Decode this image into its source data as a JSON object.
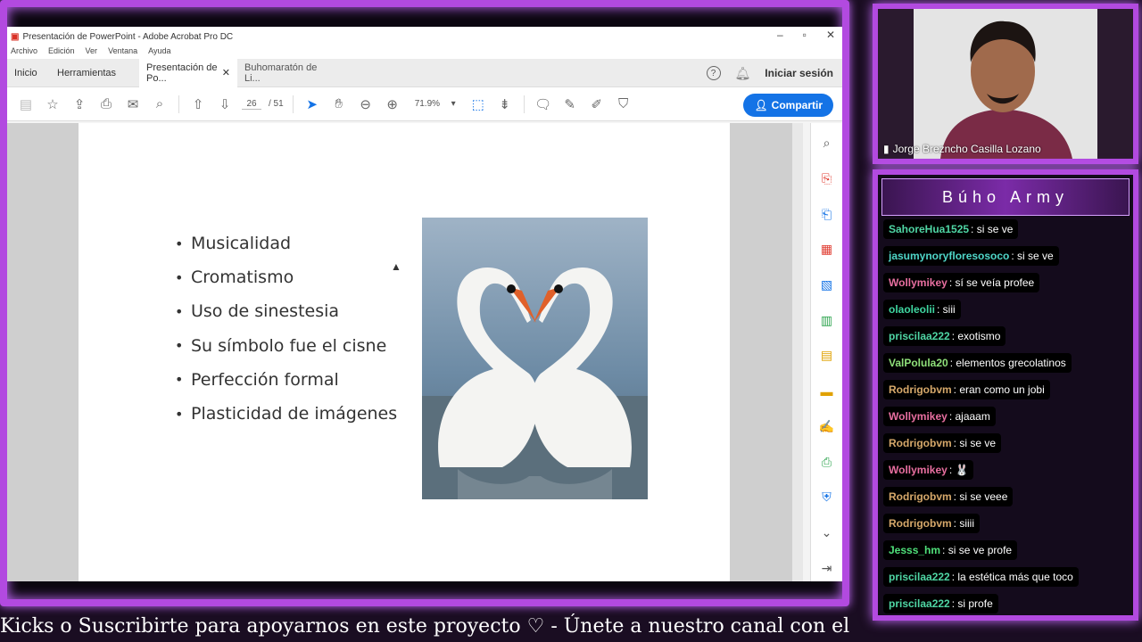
{
  "window": {
    "title": "Presentación de PowerPoint - Adobe Acrobat Pro DC",
    "menu": [
      "Archivo",
      "Edición",
      "Ver",
      "Ventana",
      "Ayuda"
    ]
  },
  "tabs": {
    "home": "Inicio",
    "tools": "Herramientas",
    "doc1": "Presentación de Po...",
    "doc2": "Buhomaratón de Li...",
    "signin": "Iniciar sesión"
  },
  "toolbar": {
    "current_page": "26",
    "total_pages": "/  51",
    "zoom": "71.9%",
    "share": "Compartir"
  },
  "slide": {
    "bullets": [
      "Musicalidad",
      "Cromatismo",
      "Uso de sinestesia",
      "Su símbolo fue el cisne",
      "Perfección formal",
      "Plasticidad de imágenes"
    ]
  },
  "camera": {
    "name": "Jorge Brezncho Casilla Lozano"
  },
  "chat": {
    "title": "Búho Army",
    "messages": [
      {
        "user": "SahoreHua1525",
        "text": ": si se ve",
        "color": "#4fd6a4"
      },
      {
        "user": "jasumynoryfloresosoco",
        "text": ": si se ve",
        "color": "#4fd6c8"
      },
      {
        "user": "Wollymikey",
        "text": ": sí se veía profee",
        "color": "#e86fa0"
      },
      {
        "user": "olaoleolii",
        "text": ": siii",
        "color": "#3fd6a0"
      },
      {
        "user": "priscilaa222",
        "text": ": exotismo",
        "color": "#4fd6a4"
      },
      {
        "user": "ValPolula20",
        "text": ": elementos grecolatinos",
        "color": "#8fe07a"
      },
      {
        "user": "Rodrigobvm",
        "text": ": eran como un jobi",
        "color": "#d6a86a"
      },
      {
        "user": "Wollymikey",
        "text": ": ajaaam",
        "color": "#e86fa0"
      },
      {
        "user": "Rodrigobvm",
        "text": ": si se ve",
        "color": "#d6a86a"
      },
      {
        "user": "Wollymikey",
        "text": ": 🐰",
        "color": "#e86fa0"
      },
      {
        "user": "Rodrigobvm",
        "text": ": si se veee",
        "color": "#d6a86a"
      },
      {
        "user": "Rodrigobvm",
        "text": ": siiii",
        "color": "#d6a86a"
      },
      {
        "user": "Jesss_hm",
        "text": ": si se ve profe",
        "color": "#4fe07a"
      },
      {
        "user": "priscilaa222",
        "text": ": la estética más que toco",
        "color": "#4fd6a4"
      },
      {
        "user": "priscilaa222",
        "text": ": si profe",
        "color": "#4fd6a4"
      }
    ]
  },
  "ticker": "Kicks o Suscribirte para apoyarnos en este proyecto  ♡   -   Únete a nuestro canal con el Link fijo"
}
